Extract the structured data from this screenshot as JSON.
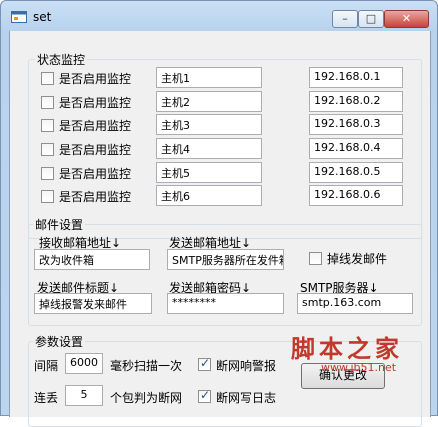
{
  "window": {
    "title": "set",
    "min": "–",
    "max": "□",
    "close": "✕"
  },
  "monitor": {
    "legend": "状态监控",
    "rows": [
      {
        "check_label": "是否启用监控",
        "checked": false,
        "host": "主机1",
        "ip": "192.168.0.1"
      },
      {
        "check_label": "是否启用监控",
        "checked": false,
        "host": "主机2",
        "ip": "192.168.0.2"
      },
      {
        "check_label": "是否启用监控",
        "checked": false,
        "host": "主机3",
        "ip": "192.168.0.3"
      },
      {
        "check_label": "是否启用监控",
        "checked": false,
        "host": "主机4",
        "ip": "192.168.0.4"
      },
      {
        "check_label": "是否启用监控",
        "checked": false,
        "host": "主机5",
        "ip": "192.168.0.5"
      },
      {
        "check_label": "是否启用监控",
        "checked": false,
        "host": "主机6",
        "ip": "192.168.0.6"
      }
    ]
  },
  "mail": {
    "legend": "邮件设置",
    "recv_label": "接收邮箱地址↓",
    "recv_value": "改为收件箱",
    "send_label": "发送邮箱地址↓",
    "send_value": "SMTP服务器所在发件箱",
    "offline_label": "掉线发邮件",
    "subject_label": "发送邮件标题↓",
    "subject_value": "掉线报警发来邮件",
    "password_label": "发送邮箱密码↓",
    "password_value": "********",
    "smtp_label": "SMTP服务器↓",
    "smtp_value": "smtp.163.com"
  },
  "params": {
    "legend": "参数设置",
    "interval_label": "间隔",
    "interval_value": "6000",
    "interval_unit": "毫秒扫描一次",
    "alarm_label": "断网响警报",
    "lost_label": "连丢",
    "lost_value": "5",
    "lost_unit": "个包判为断网",
    "log_label": "断网写日志",
    "confirm_label": "确认更改"
  },
  "watermark": {
    "text": "脚本之家",
    "url": "www.jb51.net"
  }
}
